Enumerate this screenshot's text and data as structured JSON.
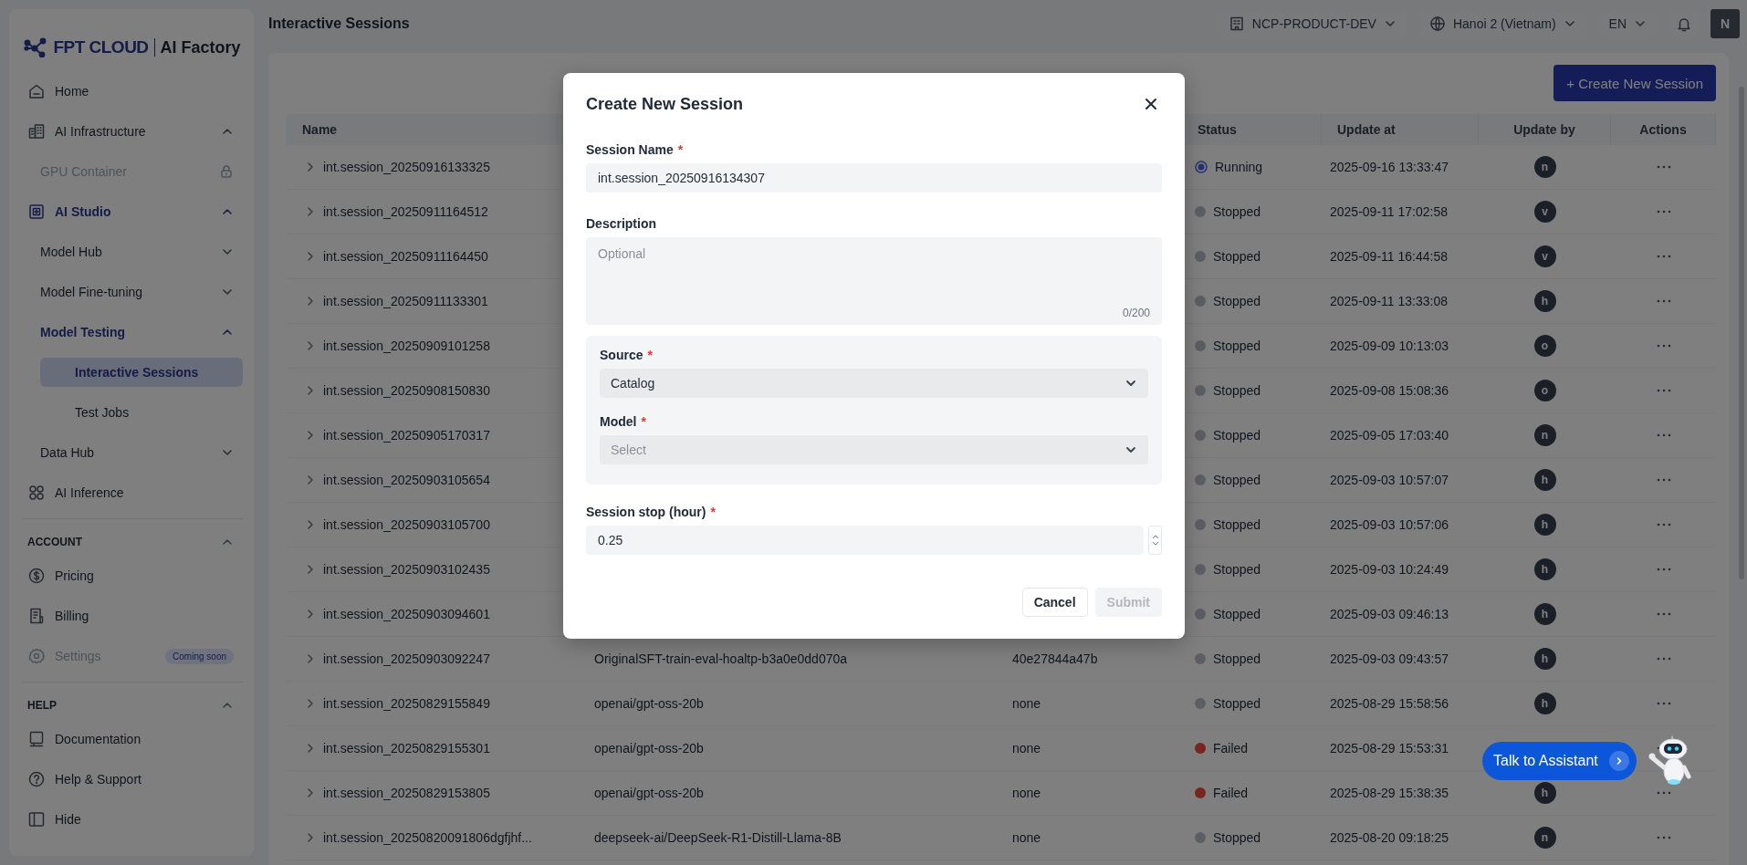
{
  "app": {
    "logo": {
      "brand": "FPT CLOUD",
      "product": "AI Factory"
    }
  },
  "sidebar": {
    "sections": [
      {
        "items": [
          {
            "label": "Home",
            "selected": false
          },
          {
            "label": "AI Infrastructure",
            "selected": false,
            "expanded": true,
            "children": [
              {
                "label": "GPU Container",
                "selected": false,
                "disabled": true
              }
            ]
          },
          {
            "label": "AI Studio",
            "selected": false,
            "active": true,
            "expanded": true,
            "children": [
              {
                "label": "Model Hub",
                "selected": false,
                "expanded": false
              },
              {
                "label": "Model Fine-tuning",
                "selected": false,
                "expanded": false
              },
              {
                "label": "Model Testing",
                "selected": false,
                "active": true,
                "expanded": true,
                "children": [
                  {
                    "label": "Interactive Sessions",
                    "selected": true
                  },
                  {
                    "label": "Test Jobs",
                    "selected": false
                  }
                ]
              },
              {
                "label": "Data Hub",
                "selected": false,
                "expanded": false
              }
            ]
          },
          {
            "label": "AI Inference",
            "selected": false
          }
        ]
      },
      {
        "title": "ACCOUNT",
        "expanded": true,
        "items": [
          {
            "label": "Pricing",
            "selected": false
          },
          {
            "label": "Billing",
            "selected": false
          },
          {
            "label": "Settings",
            "selected": false,
            "disabled": true,
            "badge": "Coming soon"
          }
        ]
      },
      {
        "title": "HELP",
        "expanded": true,
        "items": [
          {
            "label": "Documentation",
            "selected": false
          },
          {
            "label": "Help & Support",
            "selected": false
          },
          {
            "label": "Hide",
            "selected": false
          }
        ]
      }
    ]
  },
  "header": {
    "title": "Interactive Sessions",
    "project": "NCP-PRODUCT-DEV",
    "region": "Hanoi 2 (Vietnam)",
    "language": "EN",
    "user_initial": "N"
  },
  "toolbar": {
    "create_button": "+ Create New Session"
  },
  "table": {
    "columns": [
      {
        "label": "Name"
      },
      {
        "label": "Status"
      },
      {
        "label": "Update at"
      },
      {
        "label": "Update by"
      },
      {
        "label": "Actions"
      }
    ],
    "rows": [
      {
        "name": "int.session_20250916133325",
        "expanded": false,
        "status": {
          "label": "Running",
          "kind": "ring",
          "color": "#25307a"
        },
        "updated_at": "2025-09-16 13:33:47",
        "updated_by": "n"
      },
      {
        "name": "int.session_20250911164512",
        "expanded": false,
        "status": {
          "label": "Stopped",
          "kind": "dot",
          "color": "#5c5e66"
        },
        "updated_at": "2025-09-11 17:02:58",
        "updated_by": "v"
      },
      {
        "name": "int.session_20250911164450",
        "expanded": false,
        "status": {
          "label": "Stopped",
          "kind": "dot",
          "color": "#5c5e66"
        },
        "updated_at": "2025-09-11 16:44:58",
        "updated_by": "v"
      },
      {
        "name": "int.session_20250911133301",
        "expanded": false,
        "status": {
          "label": "Stopped",
          "kind": "dot",
          "color": "#5c5e66"
        },
        "updated_at": "2025-09-11 13:33:08",
        "updated_by": "h"
      },
      {
        "name": "int.session_20250909101258",
        "expanded": false,
        "status": {
          "label": "Stopped",
          "kind": "dot",
          "color": "#5c5e66"
        },
        "updated_at": "2025-09-09 10:13:03",
        "updated_by": "o"
      },
      {
        "name": "int.session_20250908150830",
        "expanded": false,
        "status": {
          "label": "Stopped",
          "kind": "dot",
          "color": "#5c5e66"
        },
        "updated_at": "2025-09-08 15:08:36",
        "updated_by": "o"
      },
      {
        "name": "int.session_20250905170317",
        "expanded": false,
        "status": {
          "label": "Stopped",
          "kind": "dot",
          "color": "#5c5e66"
        },
        "updated_at": "2025-09-05 17:03:40",
        "updated_by": "n"
      },
      {
        "name": "int.session_20250903105654",
        "expanded": false,
        "status": {
          "label": "Stopped",
          "kind": "dot",
          "color": "#5c5e66"
        },
        "updated_at": "2025-09-03 10:57:07",
        "updated_by": "h"
      },
      {
        "name": "int.session_20250903105700",
        "expanded": false,
        "status": {
          "label": "Stopped",
          "kind": "dot",
          "color": "#5c5e66"
        },
        "updated_at": "2025-09-03 10:57:06",
        "updated_by": "h"
      },
      {
        "name": "int.session_20250903102435",
        "expanded": false,
        "status": {
          "label": "Stopped",
          "kind": "dot",
          "color": "#5c5e66"
        },
        "updated_at": "2025-09-03 10:24:49",
        "updated_by": "h"
      },
      {
        "name": "int.session_20250903094601",
        "expanded": false,
        "status": {
          "label": "Stopped",
          "kind": "dot",
          "color": "#5c5e66"
        },
        "updated_at": "2025-09-03 09:46:13",
        "updated_by": "h"
      },
      {
        "name": "int.session_20250903092247",
        "column_2": "OriginalSFT-train-eval-hoaltp-b3a0e0dd070a",
        "column_3": "40e27844a47b",
        "expanded": false,
        "status": {
          "label": "Stopped",
          "kind": "dot",
          "color": "#5c5e66"
        },
        "updated_at": "2025-09-03 09:43:57",
        "updated_by": "h"
      },
      {
        "name": "int.session_20250829155849",
        "column_2": "openai/gpt-oss-20b",
        "column_3": "none",
        "expanded": false,
        "status": {
          "label": "Stopped",
          "kind": "dot",
          "color": "#5c5e66"
        },
        "updated_at": "2025-08-29 15:58:56",
        "updated_by": "h"
      },
      {
        "name": "int.session_20250829155301",
        "column_2": "openai/gpt-oss-20b",
        "column_3": "none",
        "expanded": false,
        "status": {
          "label": "Failed",
          "kind": "dot",
          "color": "#7a2420"
        },
        "updated_at": "2025-08-29 15:53:31"
      },
      {
        "name": "int.session_20250829153805",
        "column_2": "openai/gpt-oss-20b",
        "column_3": "none",
        "expanded": false,
        "status": {
          "label": "Failed",
          "kind": "dot",
          "color": "#7a2420"
        },
        "updated_at": "2025-08-29 15:38:35",
        "updated_by": "h"
      },
      {
        "name": "int.session_20250820091806dgfjhf...",
        "column_2": "deepseek-ai/DeepSeek-R1-Distill-Llama-8B",
        "column_3": "none",
        "expanded": false,
        "status": {
          "label": "Stopped",
          "kind": "dot",
          "color": "#5c5e66"
        },
        "updated_at": "2025-08-20 09:18:25",
        "updated_by": "n"
      }
    ]
  },
  "modal": {
    "title": "Create New Session",
    "fields": [
      {
        "kind": "text",
        "label": "Session Name",
        "required_mark": "*",
        "value": "int.session_20250916134307"
      },
      {
        "kind": "textarea",
        "label": "Description",
        "placeholder": "Optional",
        "counter": "0/200"
      },
      {
        "kind": "group",
        "fields": [
          {
            "kind": "select",
            "label": "Source",
            "required_mark": "*",
            "value": "Catalog"
          },
          {
            "kind": "select",
            "label": "Model",
            "required_mark": "*",
            "placeholder": "Select"
          }
        ]
      },
      {
        "kind": "number",
        "label": "Session stop (hour)",
        "required_mark": "*",
        "value": "0.25"
      }
    ],
    "buttons": [
      {
        "label": "Cancel",
        "disabled": false
      },
      {
        "label": "Submit",
        "disabled": true
      }
    ]
  },
  "assistant": {
    "label": "Talk to Assistant"
  }
}
